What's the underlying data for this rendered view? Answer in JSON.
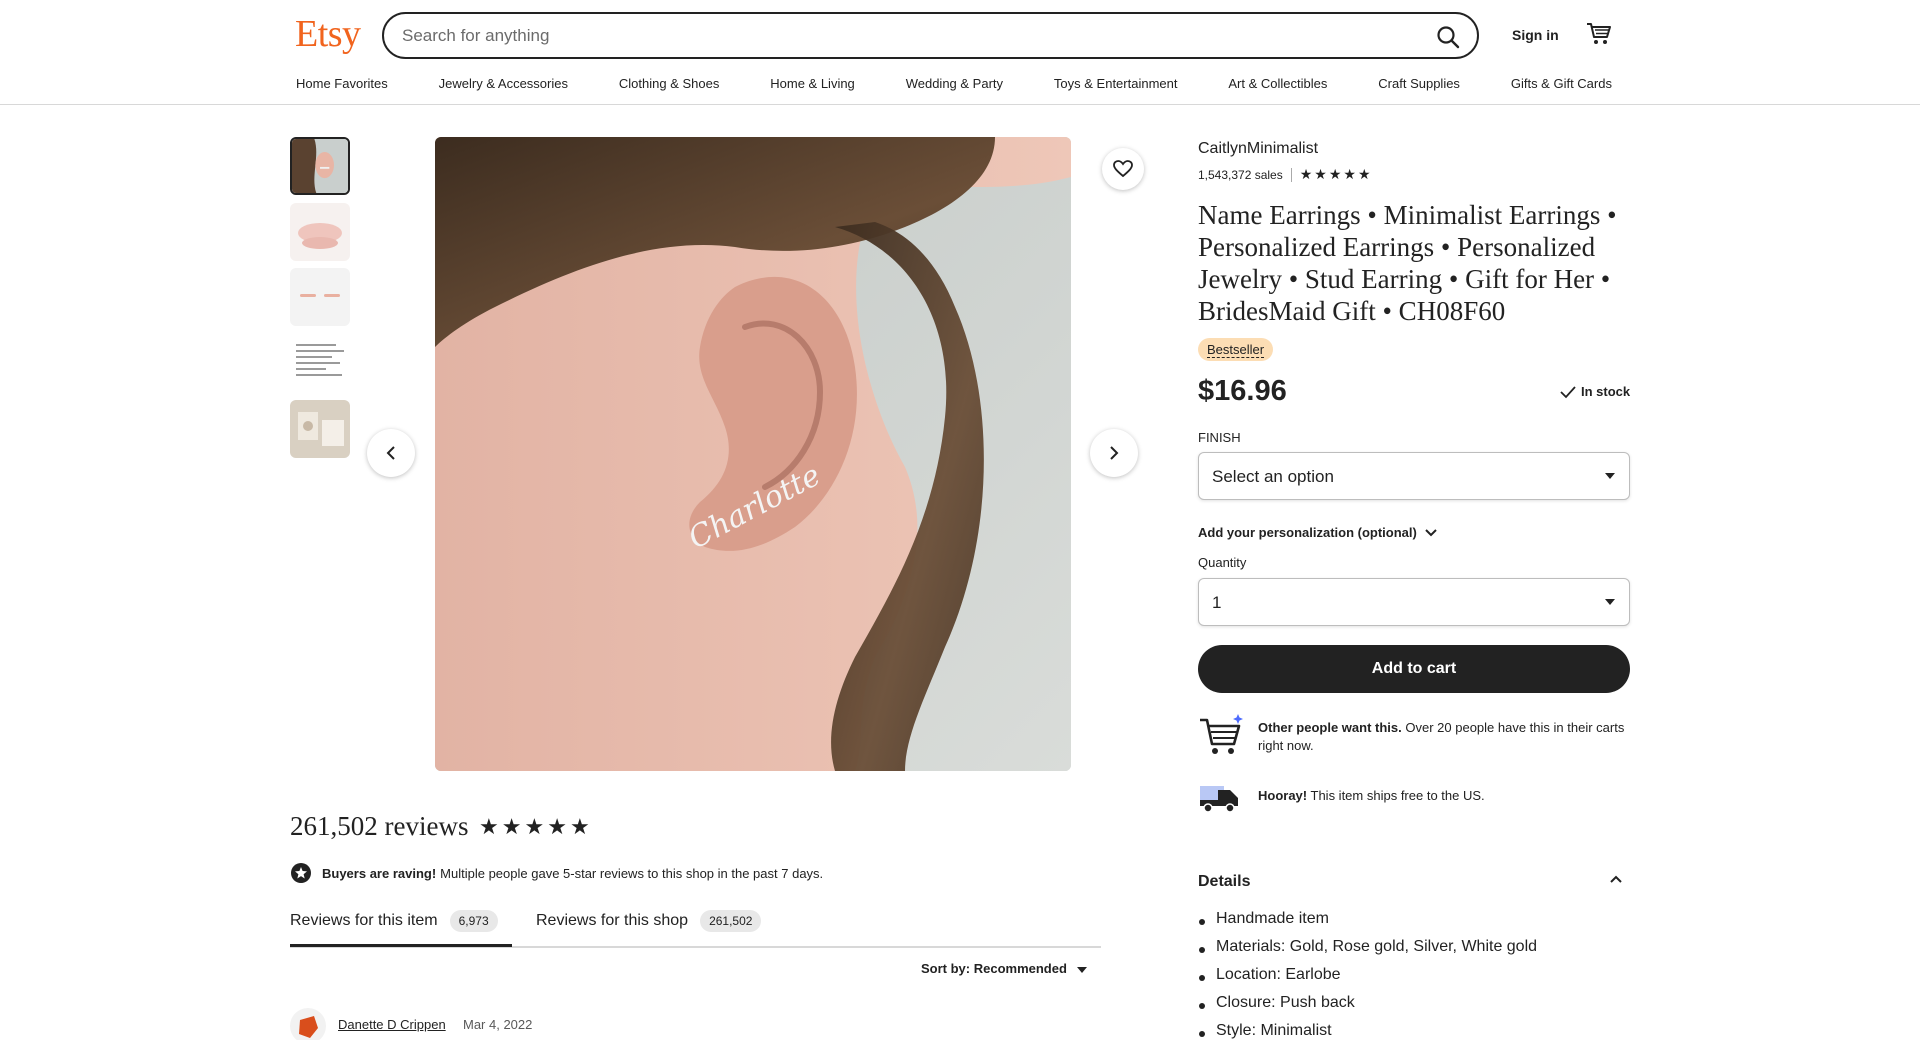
{
  "header": {
    "logo": "Etsy",
    "search_placeholder": "Search for anything",
    "sign_in": "Sign in",
    "nav": [
      "Home Favorites",
      "Jewelry & Accessories",
      "Clothing & Shoes",
      "Home & Living",
      "Wedding & Party",
      "Toys & Entertainment",
      "Art & Collectibles",
      "Craft Supplies",
      "Gifts & Gift Cards"
    ]
  },
  "gallery": {
    "thumbnail_count": 5,
    "active_index": 0,
    "engraved_name": "Charlotte"
  },
  "product": {
    "shop_name": "CaitlynMinimalist",
    "sales": "1,543,372 sales",
    "rating": 5,
    "title": "Name Earrings • Minimalist Earrings • Personalized Earrings • Personalized Jewelry • Stud Earring • Gift for Her • BridesMaid Gift • CH08F60",
    "badge": "Bestseller",
    "price": "$16.96",
    "stock": "In stock",
    "finish_label": "FINISH",
    "finish_value": "Select an option",
    "personalization": "Add your personalization (optional)",
    "quantity_label": "Quantity",
    "quantity_value": "1",
    "add_to_cart": "Add to cart"
  },
  "promos": {
    "demand_bold": "Other people want this.",
    "demand_text": "Over 20 people have this in their carts right now.",
    "ship_bold": "Hooray!",
    "ship_text": "This item ships free to the US."
  },
  "details": {
    "heading": "Details",
    "items": [
      "Handmade item",
      "Materials: Gold, Rose gold, Silver, White gold",
      "Location: Earlobe",
      "Closure: Push back",
      "Style: Minimalist"
    ]
  },
  "reviews": {
    "title": "261,502 reviews",
    "rating": 5,
    "raving_bold": "Buyers are raving!",
    "raving_text": "Multiple people gave 5-star reviews to this shop in the past 7 days.",
    "tab_item_label": "Reviews for this item",
    "tab_item_count": "6,973",
    "tab_shop_label": "Reviews for this shop",
    "tab_shop_count": "261,502",
    "sort": "Sort by: Recommended",
    "first_reviewer": "Danette D Crippen",
    "first_date": "Mar 4, 2022"
  },
  "colors": {
    "brand": "#f1641e",
    "primary_button": "#222222",
    "badge_bg": "#fcddb4"
  }
}
